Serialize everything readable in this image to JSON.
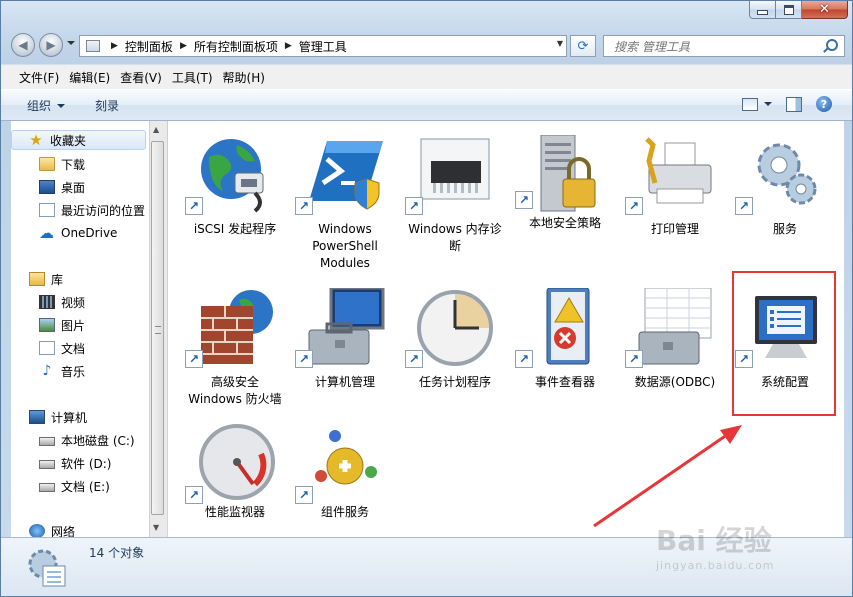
{
  "window": {
    "close_glyph": "✕"
  },
  "address": {
    "crumbs": [
      "控制面板",
      "所有控制面板项",
      "管理工具"
    ],
    "sep": "▶",
    "dropdown": "▼",
    "refresh_glyph": "⟳"
  },
  "search": {
    "placeholder": "搜索 管理工具"
  },
  "menubar": {
    "items": [
      "文件(F)",
      "编辑(E)",
      "查看(V)",
      "工具(T)",
      "帮助(H)"
    ]
  },
  "toolbar": {
    "organize_label": "组织",
    "burn_label": "刻录",
    "help_glyph": "?"
  },
  "navpane": {
    "favorites": "收藏夹",
    "downloads": "下载",
    "desktop": "桌面",
    "recent": "最近访问的位置",
    "onedrive": "OneDrive",
    "libraries": "库",
    "videos": "视频",
    "pictures": "图片",
    "documents": "文档",
    "music": "音乐",
    "computer": "计算机",
    "disk_c": "本地磁盘 (C:)",
    "disk_d": "软件 (D:)",
    "disk_e": "文档 (E:)",
    "network": "网络"
  },
  "items": [
    {
      "label": "iSCSI 发起程序"
    },
    {
      "label": "Windows\nPowerShell\nModules"
    },
    {
      "label": "Windows 内存诊\n断"
    },
    {
      "label": "本地安全策略"
    },
    {
      "label": "打印管理"
    },
    {
      "label": "服务"
    },
    {
      "label": "高级安全\nWindows 防火墙"
    },
    {
      "label": "计算机管理"
    },
    {
      "label": "任务计划程序"
    },
    {
      "label": "事件查看器"
    },
    {
      "label": "数据源(ODBC)"
    },
    {
      "label": "系统配置"
    },
    {
      "label": "性能监视器"
    },
    {
      "label": "组件服务"
    }
  ],
  "shortcut_glyph": "↗",
  "status": {
    "count_text": "14 个对象"
  },
  "watermark": {
    "text": "Bai 经验",
    "sub": "jingyan.baidu.com"
  },
  "colors": {
    "highlight": "#e8353a",
    "arrow": "#e8353a"
  }
}
